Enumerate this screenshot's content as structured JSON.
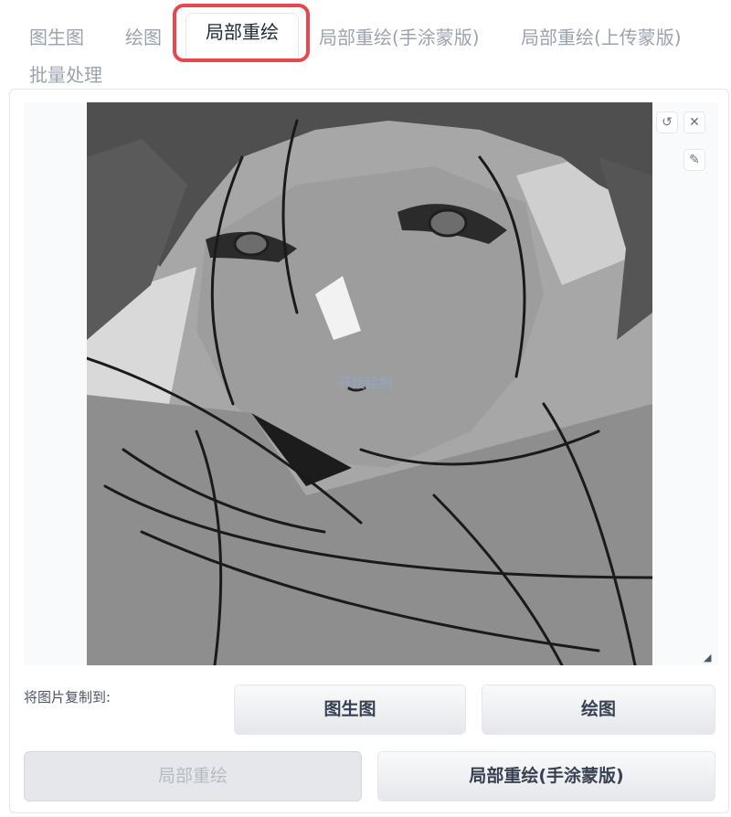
{
  "tabs": [
    {
      "label": "图生图"
    },
    {
      "label": "绘图"
    },
    {
      "label": "局部重绘"
    },
    {
      "label": "局部重绘(手涂蒙版)"
    },
    {
      "label": "局部重绘(上传蒙版)"
    },
    {
      "label": "批量处理"
    }
  ],
  "active_tab": "局部重绘",
  "highlight_color": "#e5484d",
  "canvas": {
    "hint": "开始绘制",
    "tools": {
      "undo_icon": "undo-icon",
      "clear_icon": "close-icon",
      "brush_icon": "brush-icon"
    }
  },
  "copy_to": {
    "label": "将图片复制到:",
    "buttons": [
      {
        "label": "图生图",
        "disabled": false
      },
      {
        "label": "绘图",
        "disabled": false
      },
      {
        "label": "局部重绘",
        "disabled": true
      },
      {
        "label": "局部重绘(手涂蒙版)",
        "disabled": false
      }
    ]
  }
}
